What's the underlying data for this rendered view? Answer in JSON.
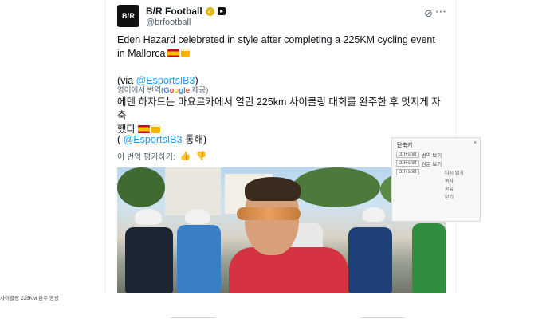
{
  "post": {
    "avatar_text": "B/R",
    "display_name": "B/R Football",
    "handle": "@brfootball",
    "icons": [
      "verified-badge-icon",
      "affiliate-badge-icon",
      "grok-icon",
      "more-icon"
    ],
    "text_line1": "Eden Hazard celebrated in style after completing a 225KM cycling event",
    "text_line2": "in Mallorca",
    "via_open": "(via ",
    "via_mention": "@EsportsIB3",
    "via_close": ")",
    "translated_prefix": "영어에서 번역(",
    "translated_google": [
      "G",
      "o",
      "o",
      "g",
      "l",
      "e"
    ],
    "translated_suffix": " 제공)",
    "ko_line1": "에덴 하자드는 마요르카에서 열린 225km 사이클링 대회를 완주한 후 멋지게 자축",
    "ko_line2": "했다",
    "ko_via_open": "( ",
    "ko_via_mention": "@EsportsIB3",
    "ko_via_close": " 통해)",
    "rate_text": "이 번역 평가하기:",
    "rate_icons": [
      "thumbs-up-icon",
      "thumbs-down-icon"
    ]
  },
  "sidepanel": {
    "title": "단축키",
    "items": [
      {
        "chip": "ctrl+shift",
        "label": "번역 보기"
      },
      {
        "chip": "ctrl+shift",
        "label": "원문 보기"
      },
      {
        "chip": "ctrl+shift",
        "label": ""
      }
    ],
    "list": [
      "",
      "",
      "다시 읽기",
      "",
      "",
      "",
      "복사",
      "공유",
      "닫기"
    ]
  },
  "caption": "사이클링 225KM 완주 영상"
}
